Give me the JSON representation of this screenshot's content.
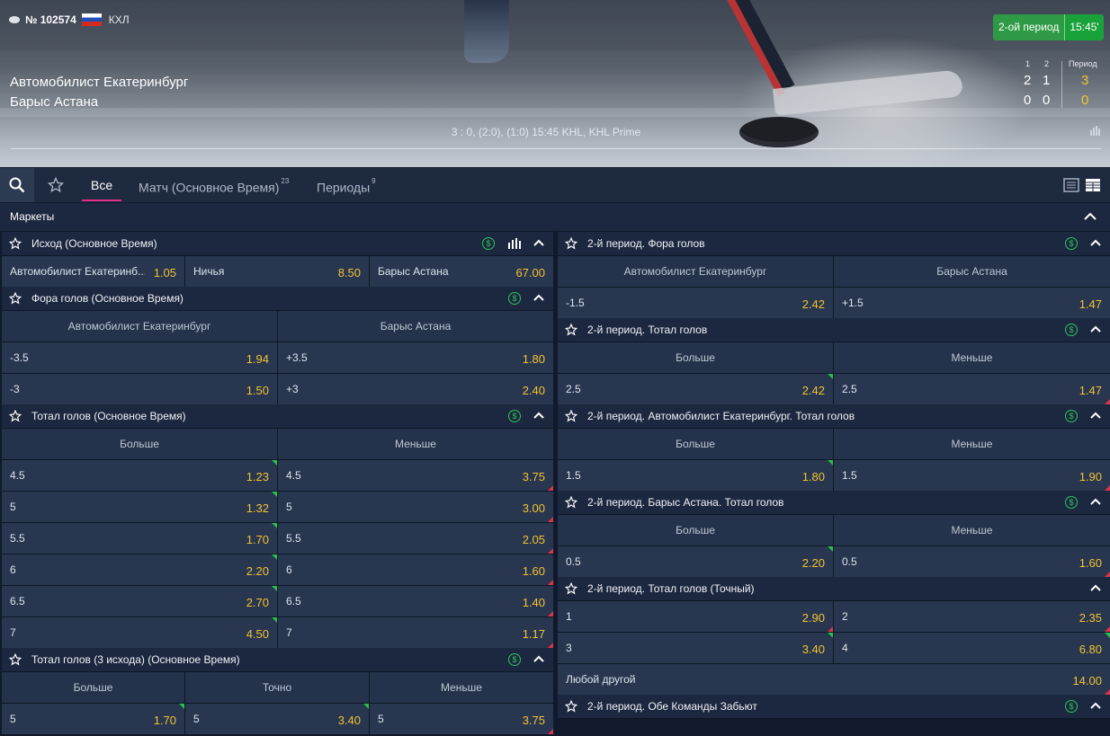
{
  "header": {
    "match_number": "№ 102574",
    "league": "КХЛ",
    "period": "2-ой период",
    "time": "15:45'",
    "team1": "Автомобилист Екатеринбург",
    "team2": "Барыс Астана",
    "score_head_1": "1",
    "score_head_2": "2",
    "score_head_period": "Период",
    "t1_p1": "2",
    "t1_p2": "1",
    "t1_period": "3",
    "t2_p1": "0",
    "t2_p2": "0",
    "t2_period": "0",
    "info": "3 : 0, (2:0), (1:0) 15:45 KHL, KHL Prime"
  },
  "tabs": {
    "all": "Все",
    "match": "Матч (Основное Время)",
    "match_count": "23",
    "periods": "Периоды",
    "periods_count": "9"
  },
  "markets_label": "Маркеты",
  "left": {
    "m1": {
      "title": "Исход (Основное Время)",
      "c1_name": "Автомобилист Екатеринб...",
      "c1_odd": "1.05",
      "c2_name": "Ничья",
      "c2_odd": "8.50",
      "c3_name": "Барыс Астана",
      "c3_odd": "67.00"
    },
    "m2": {
      "title": "Фора голов (Основное Время)",
      "h1": "Автомобилист Екатеринбург",
      "h2": "Барыс Астана",
      "rows": [
        {
          "a": "-3.5",
          "ao": "1.94",
          "b": "+3.5",
          "bo": "1.80"
        },
        {
          "a": "-3",
          "ao": "1.50",
          "b": "+3",
          "bo": "2.40"
        }
      ]
    },
    "m3": {
      "title": "Тотал голов (Основное Время)",
      "h1": "Больше",
      "h2": "Меньше",
      "rows": [
        {
          "a": "4.5",
          "ao": "1.23",
          "b": "4.5",
          "bo": "3.75"
        },
        {
          "a": "5",
          "ao": "1.32",
          "b": "5",
          "bo": "3.00"
        },
        {
          "a": "5.5",
          "ao": "1.70",
          "b": "5.5",
          "bo": "2.05"
        },
        {
          "a": "6",
          "ao": "2.20",
          "b": "6",
          "bo": "1.60"
        },
        {
          "a": "6.5",
          "ao": "2.70",
          "b": "6.5",
          "bo": "1.40"
        },
        {
          "a": "7",
          "ao": "4.50",
          "b": "7",
          "bo": "1.17"
        }
      ]
    },
    "m4": {
      "title": "Тотал голов (3 исхода) (Основное Время)",
      "h1": "Больше",
      "h2": "Точно",
      "h3": "Меньше",
      "r1": {
        "a": "5",
        "ao": "1.70",
        "b": "5",
        "bo": "3.40",
        "c": "5",
        "co": "3.75"
      }
    }
  },
  "right": {
    "m1": {
      "title": "2-й период. Фора голов",
      "h1": "Автомобилист Екатеринбург",
      "h2": "Барыс Астана",
      "a": "-1.5",
      "ao": "2.42",
      "b": "+1.5",
      "bo": "1.47"
    },
    "m2": {
      "title": "2-й период. Тотал голов",
      "h1": "Больше",
      "h2": "Меньше",
      "a": "2.5",
      "ao": "2.42",
      "b": "2.5",
      "bo": "1.47"
    },
    "m3": {
      "title": "2-й период. Автомобилист Екатеринбург. Тотал голов",
      "h1": "Больше",
      "h2": "Меньше",
      "a": "1.5",
      "ao": "1.80",
      "b": "1.5",
      "bo": "1.90"
    },
    "m4": {
      "title": "2-й период. Барыс Астана. Тотал голов",
      "h1": "Больше",
      "h2": "Меньше",
      "a": "0.5",
      "ao": "2.20",
      "b": "0.5",
      "bo": "1.60"
    },
    "m5": {
      "title": "2-й период. Тотал голов (Точный)",
      "r1": {
        "a": "1",
        "ao": "2.90",
        "b": "2",
        "bo": "2.35"
      },
      "r2": {
        "a": "3",
        "ao": "3.40",
        "b": "4",
        "bo": "6.80"
      },
      "other": "Любой другой",
      "other_odd": "14.00"
    },
    "m6": {
      "title": "2-й период. Обе Команды Забьют"
    }
  },
  "colors": {
    "accent": "#e0308a",
    "odd": "#f2c230",
    "up": "#27c04a",
    "down": "#e0334a",
    "live": "#19a23a"
  }
}
